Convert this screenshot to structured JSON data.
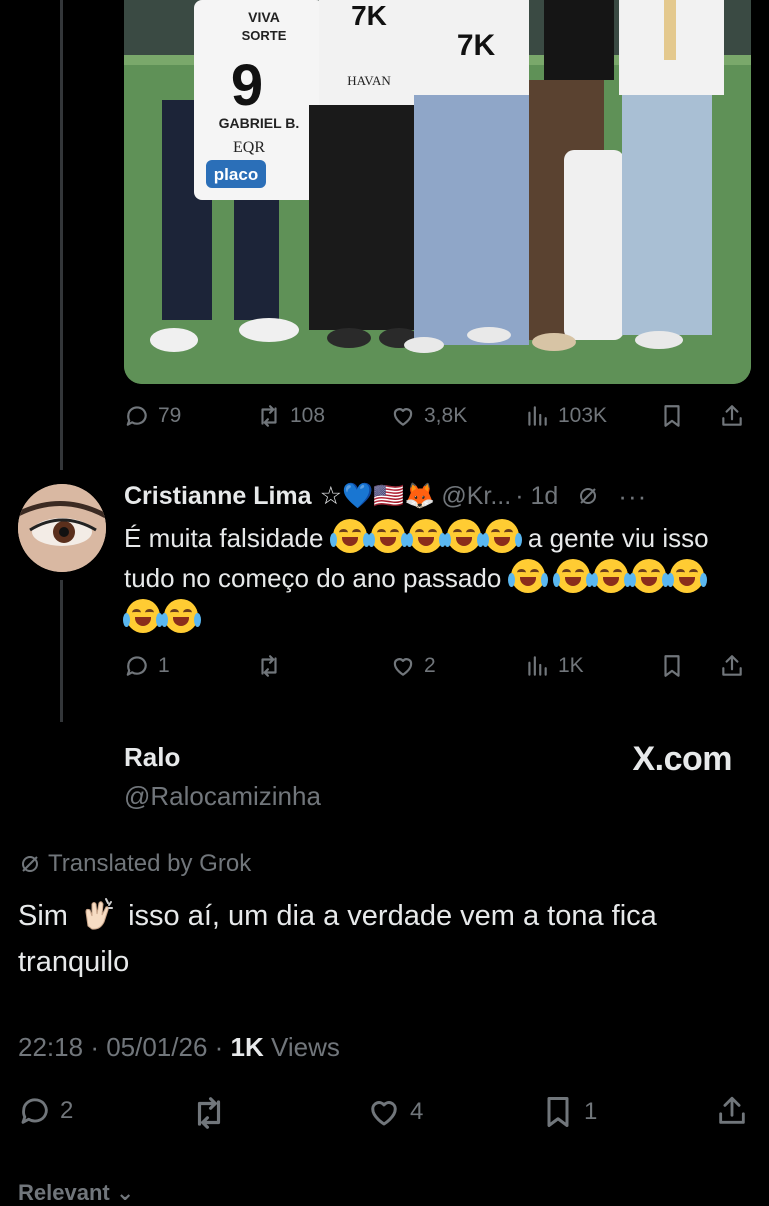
{
  "tweet": {
    "stats": {
      "replies": "79",
      "retweets": "108",
      "likes": "3,8K",
      "views": "103K"
    },
    "photo_jersey": {
      "sponsor_top": "VIVA",
      "sponsor_top2": "SORTE",
      "number": "9",
      "player": "GABRIEL B.",
      "sponsor_mid": "EQR",
      "sponsor_bottom": "placo",
      "brand": "7K",
      "havan": "HAVAN"
    }
  },
  "reply": {
    "display_name": "Cristianne Lima",
    "name_suffix": "☆💙🇺🇸🦊",
    "handle": "@Kr...",
    "time": "· 1d",
    "text_part1": "É muita falsidade",
    "text_part2": "a gente viu isso tudo no começo do ano passado",
    "stats": {
      "replies": "1",
      "retweets": "",
      "likes": "2",
      "views": "1K"
    }
  },
  "card": {
    "name": "Ralo",
    "handle": "@Ralocamizinha",
    "brand": "X.com",
    "translated_label": "Translated by Grok",
    "text_part1": "Sim",
    "text_part2": "isso aí, um dia a verdade vem a tona fica tranquilo",
    "time": "22:18",
    "date": "05/01/26",
    "views_count": "1K",
    "views_label": "Views",
    "stats": {
      "replies": "2",
      "retweets": "",
      "likes": "4",
      "bookmarks": "1"
    }
  },
  "footer": {
    "sort_label": "Relevant ⌄"
  }
}
